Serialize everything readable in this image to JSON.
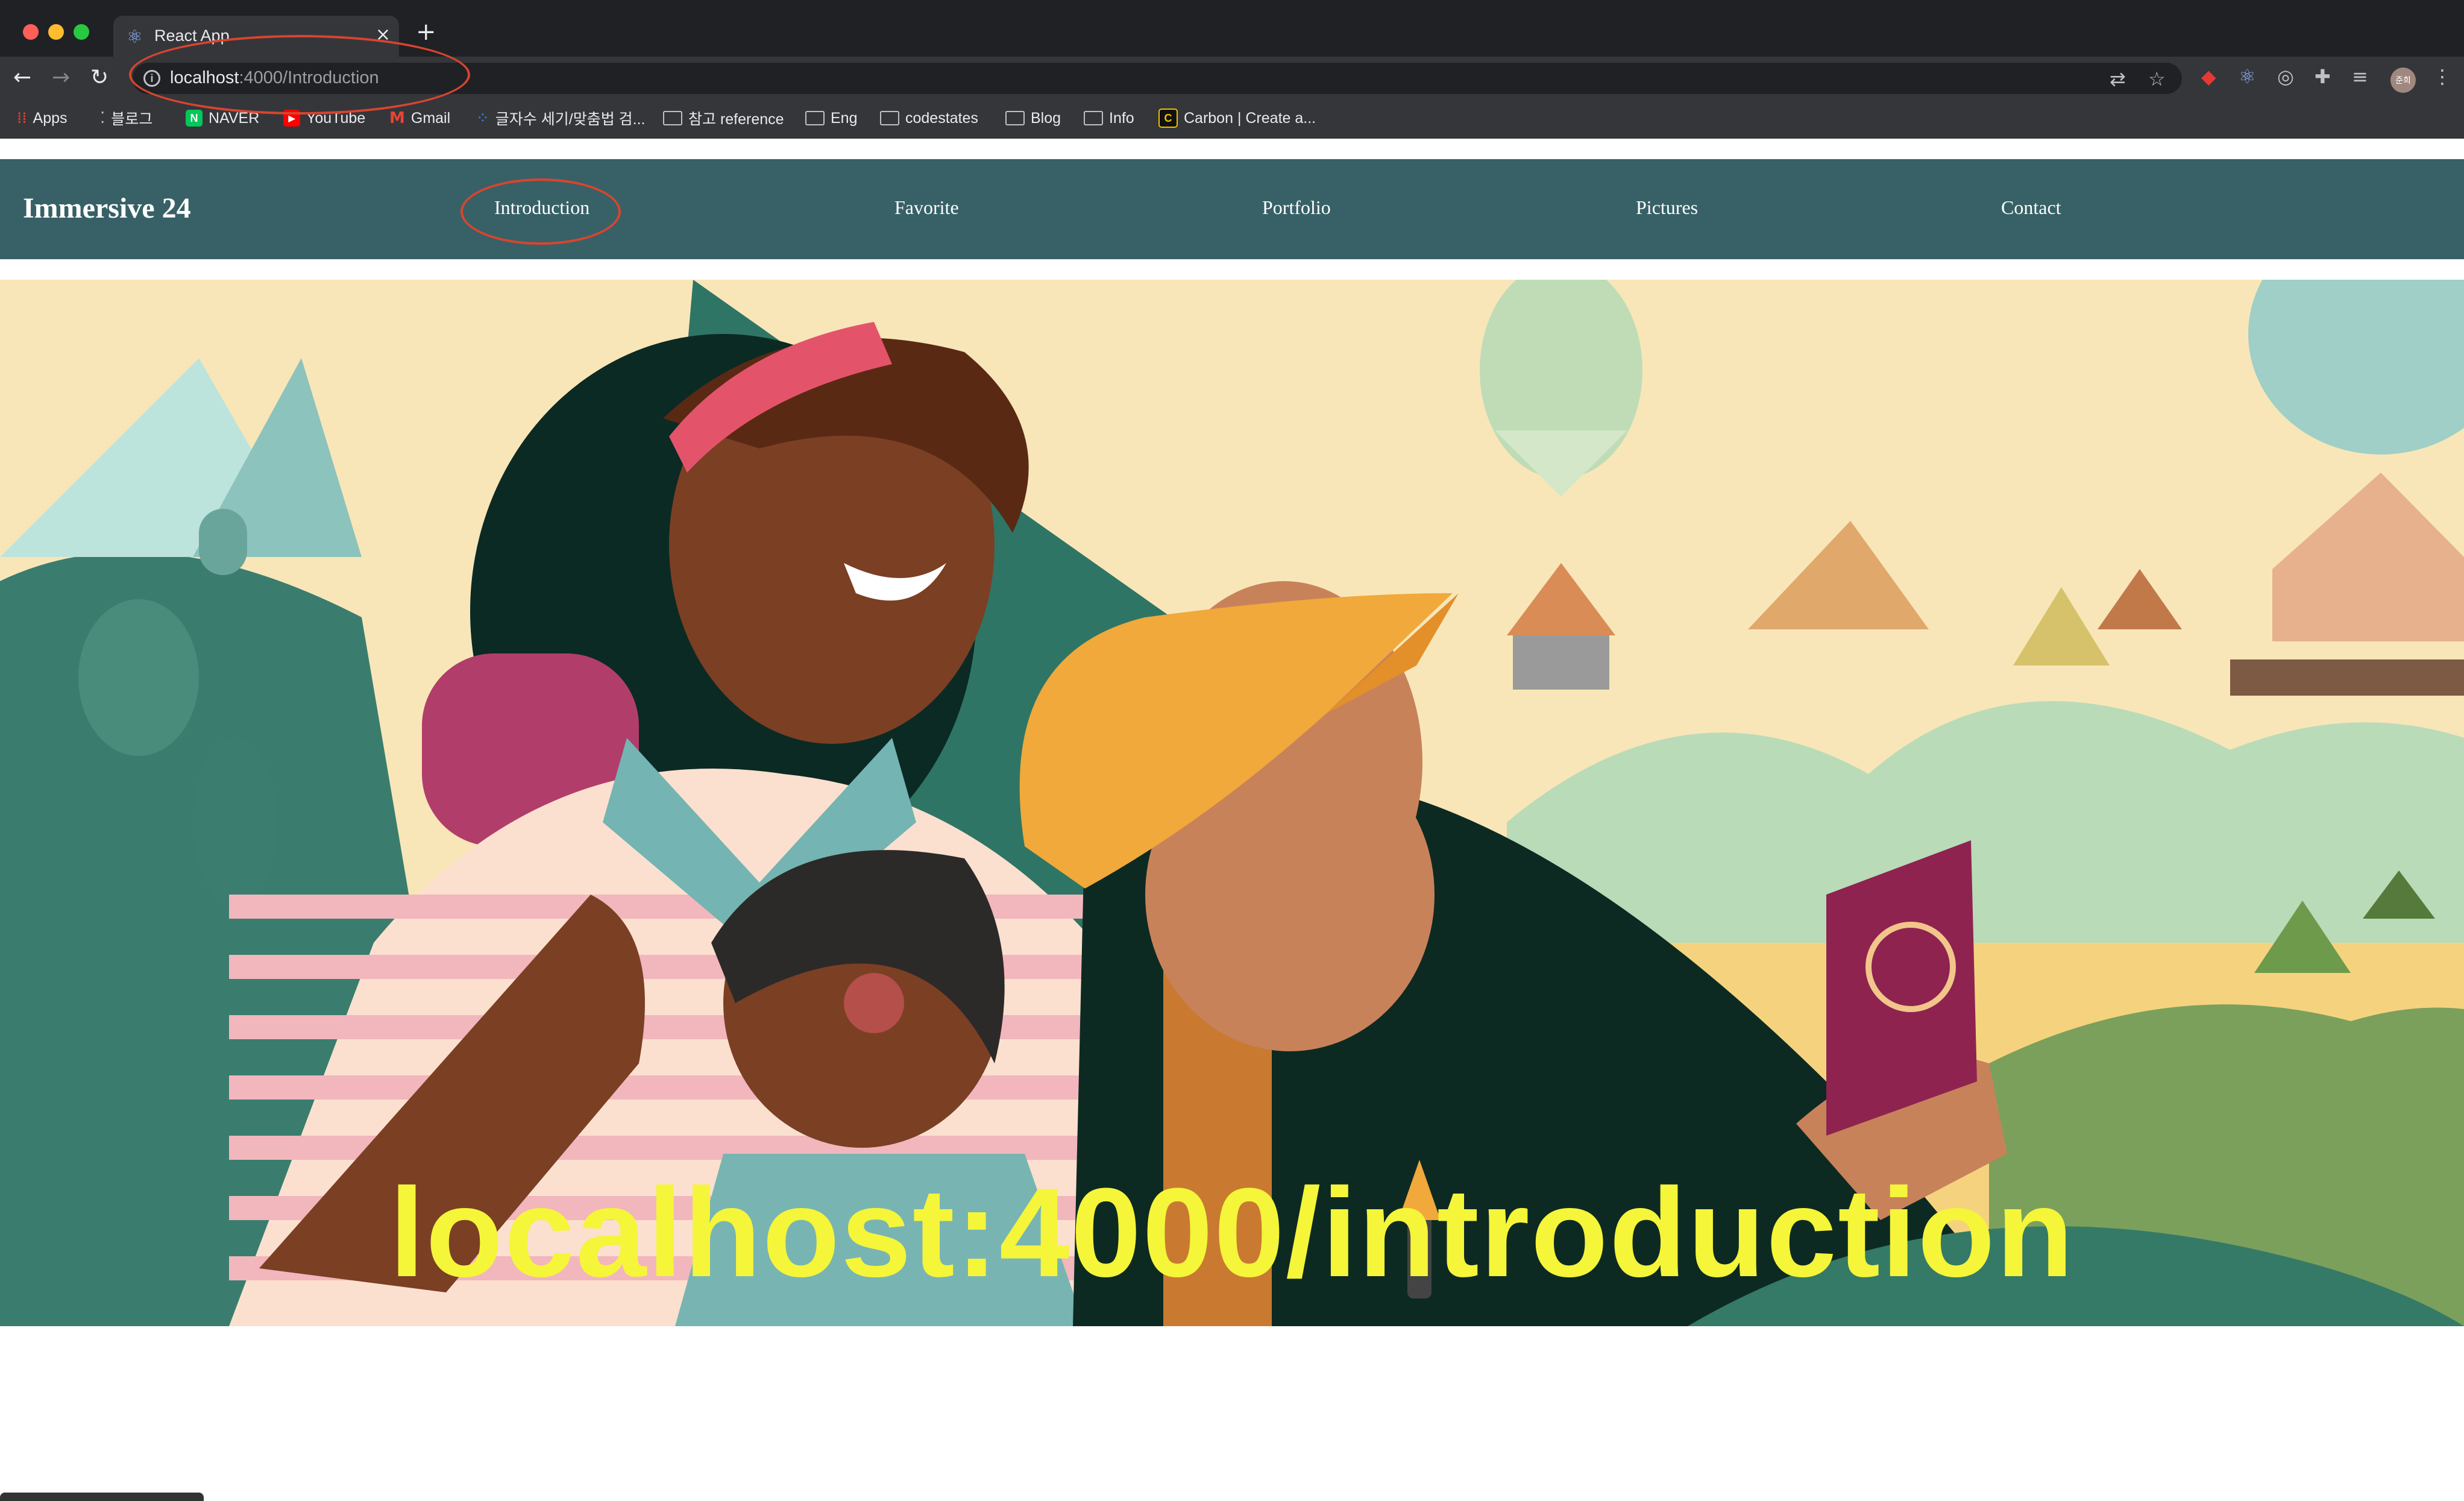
{
  "browser": {
    "tab": {
      "title": "React App",
      "icon": "react-icon",
      "close": "×"
    },
    "new_tab": "+",
    "url": {
      "host": "localhost",
      "path": ":4000/Introduction"
    },
    "bookmarks": [
      {
        "label": "Apps",
        "icon": "apps-grid-icon"
      },
      {
        "label": "블로그",
        "icon": "blog-icon"
      },
      {
        "label": "NAVER",
        "icon": "naver-icon"
      },
      {
        "label": "YouTube",
        "icon": "youtube-icon"
      },
      {
        "label": "Gmail",
        "icon": "gmail-icon"
      },
      {
        "label": "글자수 세기/맞춤법 검...",
        "icon": "dots-icon"
      },
      {
        "label": "참고 reference",
        "icon": "folder-icon"
      },
      {
        "label": "Eng",
        "icon": "folder-icon"
      },
      {
        "label": "codestates",
        "icon": "folder-icon"
      },
      {
        "label": "Blog",
        "icon": "folder-icon"
      },
      {
        "label": "Info",
        "icon": "folder-icon"
      },
      {
        "label": "Carbon | Create a...",
        "icon": "carbon-icon"
      }
    ],
    "profile_initials": "준희"
  },
  "site": {
    "brand": "Immersive 24",
    "nav": [
      "Introduction",
      "Favorite",
      "Portfolio",
      "Pictures",
      "Contact"
    ],
    "active_nav": "Introduction"
  },
  "overlay_caption": "localhost:4000/introduction",
  "colors": {
    "navbar": "#376166",
    "overlay_text": "#f5f53a",
    "annotation": "#d9442f"
  }
}
